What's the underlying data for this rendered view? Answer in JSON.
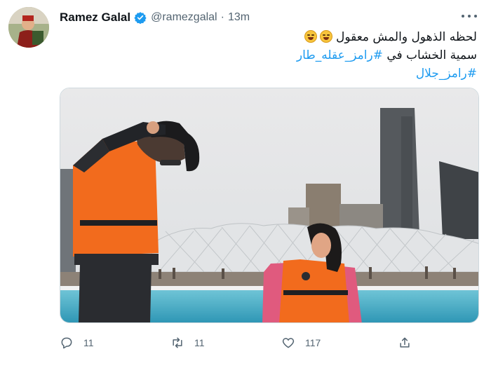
{
  "tweet": {
    "author": {
      "name": "Ramez Galal",
      "handle": "@ramezgalal",
      "verified": true
    },
    "separator": "·",
    "timestamp": "13m",
    "text": {
      "line1": "لحظه الذهول والمش معقول",
      "line2_prefix": "سمية الخشاب في ",
      "line2_hashtag": "#رامز_عقله_طار",
      "line3_hashtag": "#رامز_جلال"
    },
    "actions": {
      "reply_count": "11",
      "retweet_count": "11",
      "like_count": "117"
    }
  },
  "colors": {
    "link": "#1d9bf0",
    "muted": "#536471",
    "verified": "#1d9bf0",
    "life_vest": "#f26b1d"
  },
  "icons": [
    "verified-badge-icon",
    "more-icon",
    "reply-icon",
    "retweet-icon",
    "like-icon",
    "share-icon"
  ]
}
